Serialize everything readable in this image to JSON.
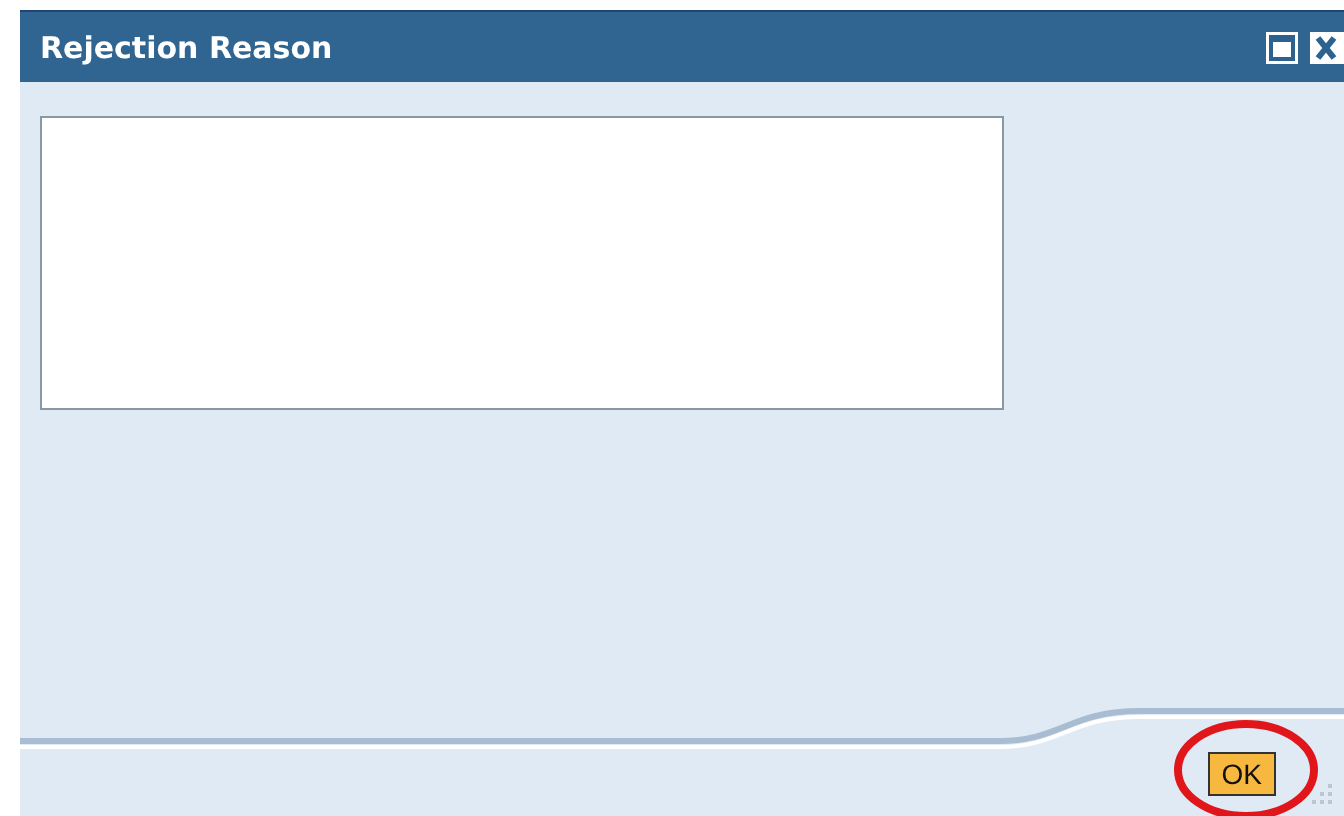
{
  "window": {
    "title": "Rejection Reason"
  },
  "buttons": [
    {
      "label": "OK"
    }
  ]
}
